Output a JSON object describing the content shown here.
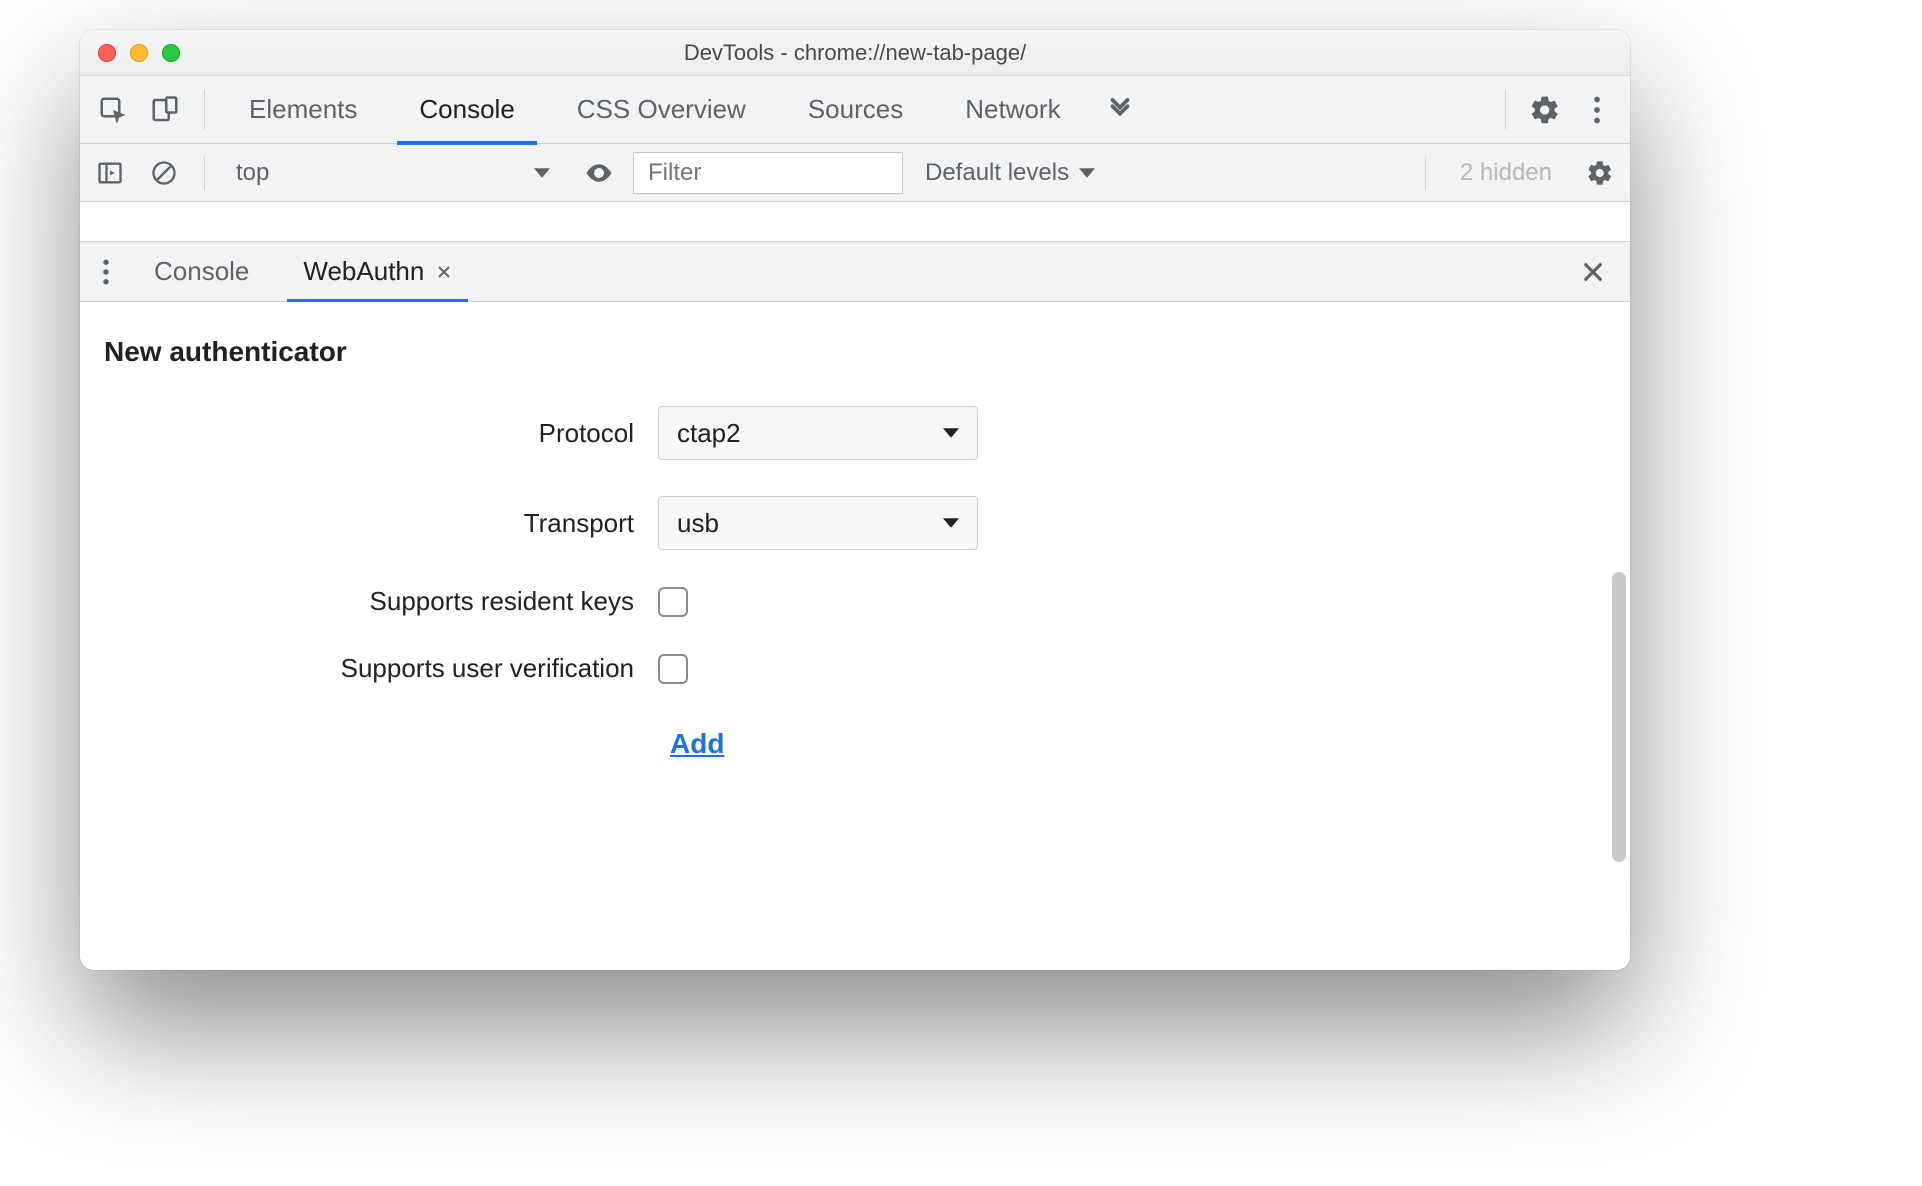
{
  "window": {
    "title": "DevTools - chrome://new-tab-page/"
  },
  "main_tabs": {
    "elements": "Elements",
    "console": "Console",
    "css_overview": "CSS Overview",
    "sources": "Sources",
    "network": "Network"
  },
  "console_bar": {
    "context": "top",
    "filter_placeholder": "Filter",
    "levels_label": "Default levels",
    "hidden_label": "2 hidden"
  },
  "drawer": {
    "tab_console": "Console",
    "tab_webauthn": "WebAuthn"
  },
  "webauthn": {
    "section_title": "New authenticator",
    "labels": {
      "protocol": "Protocol",
      "transport": "Transport",
      "resident_keys": "Supports resident keys",
      "user_verification": "Supports user verification"
    },
    "values": {
      "protocol": "ctap2",
      "transport": "usb"
    },
    "add_label": "Add"
  }
}
